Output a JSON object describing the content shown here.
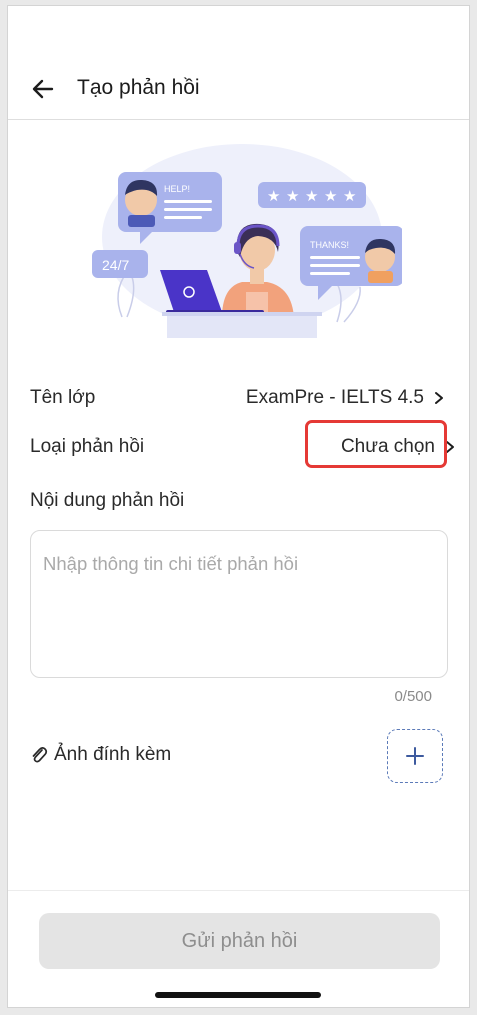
{
  "header": {
    "title": "Tạo phản hồi",
    "back_icon": "arrow-left-icon"
  },
  "illustration": {
    "help_text": "HELP!",
    "thanks_text": "THANKS!",
    "hours_text": "24/7",
    "stars": 5
  },
  "form": {
    "class_label": "Tên lớp",
    "class_value": "ExamPre - IELTS 4.5",
    "type_label": "Loại phản hồi",
    "type_value": "Chưa chọn",
    "content_label": "Nội dung phản hồi",
    "content_placeholder": "Nhập thông tin chi tiết phản hồi",
    "content_value": "",
    "counter": "0/500",
    "attachment_label": "Ảnh đính kèm",
    "attachment_icon": "paperclip-icon",
    "add_icon": "plus-icon"
  },
  "footer": {
    "submit_label": "Gửi phản hồi"
  },
  "colors": {
    "highlight": "#e53935",
    "accent": "#5b7ab8",
    "disabled_bg": "#e4e4e4",
    "disabled_text": "#8e8e8e"
  }
}
